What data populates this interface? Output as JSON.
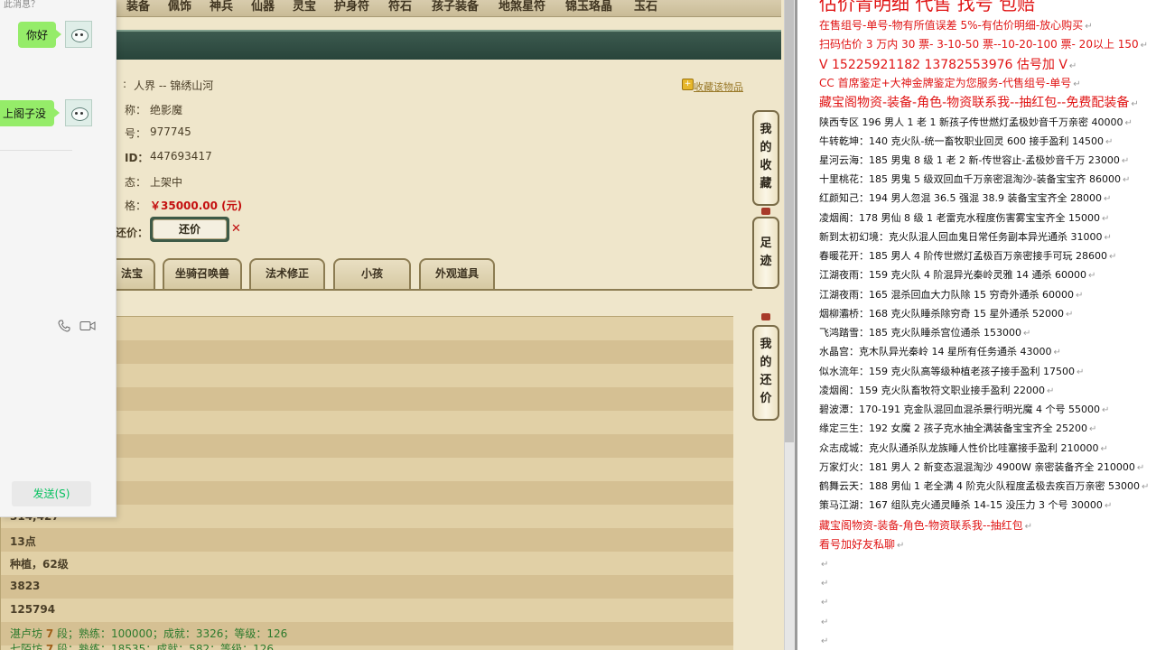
{
  "nav": [
    "装备",
    "佩饰",
    "神兵",
    "仙器",
    "灵宝",
    "护身符",
    "符石",
    "孩子装备",
    "地煞星符",
    "锦玉珞晶",
    "玉石"
  ],
  "item": {
    "server_label": ":",
    "server_value": "人界 -- 锦绣山河",
    "name_key": "称：",
    "name_value": "绝影魔",
    "num_key": "号：",
    "num_value": "977745",
    "id_key": "ID：",
    "id_value": "447693417",
    "status_key": "态：",
    "status_value": "上架中",
    "price_key": "格：",
    "price_value": "￥35000.00 (元)",
    "haggle_key": "还价：",
    "haggle_button": "还价",
    "haggle_close": "✕",
    "favorite_link": "收藏该物品"
  },
  "tabs": [
    "法宝",
    "坐骑召唤兽",
    "法术修正",
    "小孩",
    "外观道具"
  ],
  "side_buttons": [
    {
      "label": "我的收藏",
      "chars": [
        "我",
        "的",
        "收",
        "藏"
      ]
    },
    {
      "label": "足迹",
      "chars": [
        "足",
        "迹"
      ]
    },
    {
      "label": "我的还价",
      "chars": [
        "我",
        "的",
        "还",
        "价"
      ]
    }
  ],
  "stats": {
    "s1": "314,427",
    "s2": "13点",
    "s3": "种植，62级",
    "s4": "3823",
    "s5": "125794",
    "line_a_name": "湛卢坊",
    "line_a_level": "7",
    "line_a_text": "段；熟练：100000；成就：3326；等级：126",
    "line_b_name": "七陌坊",
    "line_b_level": "7",
    "line_b_text": "段；熟练：18535；成就：582；等级：126"
  },
  "chat": {
    "top_hint": "此消息？",
    "messages": [
      "你好",
      "上阁子没"
    ],
    "send_button": "发送(S)"
  },
  "notes": {
    "header": "估价青明细 代售 找号 包赔",
    "red_lines": [
      "在售组号-单号-物有所值误差 5%-有估价明细-放心购买",
      "扫码估价 3 万内 30 票- 3-10-50 票--10-20-100 票- 20以上 150",
      "V 15225921182    13782553976    估号加 V",
      "CC 首席鉴定+大神金牌鉴定为您服务-代售组号-单号",
      "藏宝阁物资-装备-角色-物资联系我--抽红包--免费配装备"
    ],
    "entries": [
      "陕西专区 196 男人 1 老 1 新孩子传世燃灯孟极妙音千万亲密 40000",
      "牛转乾坤：140 克火队-统一畜牧职业回灵 600 接手盈利 14500",
      "星河云海：185 男鬼 8 级 1 老 2 新-传世容止-孟极妙音千万 23000",
      "十里桃花：185 男鬼 5 级双回血千万亲密混淘沙-装备宝宝齐 86000",
      "红颜知己：194 男人忽混 36.5 强混 38.9 装备宝宝齐全 28000",
      "凌烟阁：178 男仙 8 级 1 老雷克水程度伤害雾宝宝齐全 15000",
      "新到太初幻境：克火队混人回血鬼日常任务副本异光通杀 31000",
      "春暖花开：185 男人 4 阶传世燃灯孟极百万亲密接手可玩 28600",
      "江湖夜雨：159 克火队 4 阶混异光秦岭灵雅 14 通杀 60000",
      "江湖夜雨：165 混杀回血大力队除 15 穷奇外通杀 60000",
      "烟柳灞桥：168 克火队睡杀除穷奇 15 星外通杀 52000",
      "飞鸿踏雪：185 克火队睡杀宫位通杀 153000",
      "水晶宫：克木队异光秦岭 14 星所有任务通杀 43000",
      "似水流年：159 克火队高等级种植老孩子接手盈利 17500",
      "凌烟阁：159 克火队畜牧符文职业接手盈利 22000",
      "碧波潭：170-191 克金队混回血混杀景行明光魔 4 个号 55000",
      "缘定三生：192 女魔 2 孩子克水抽全满装备宝宝齐全 25200",
      "众志成城：克火队通杀队龙族睡人性价比哇塞接手盈利 210000",
      "万家灯火：181 男人 2 新变态混混淘沙 4900W 亲密装备齐全 210000",
      "鹤舞云天：188 男仙 1 老全满 4 阶克火队程度孟极去疾百万亲密 53000",
      "策马江湖：167 组队克火通灵睡杀 14-15 没压力 3 个号 30000"
    ],
    "footer_red": [
      "藏宝阁物资-装备-角色-物资联系我--抽红包",
      "看号加好友私聊"
    ],
    "para_mark": "↵"
  },
  "colors": {
    "price": "#c41010",
    "chat_bubble": "#95ec69",
    "notes_red": "#e01414",
    "dark_bar": "#28443a"
  }
}
